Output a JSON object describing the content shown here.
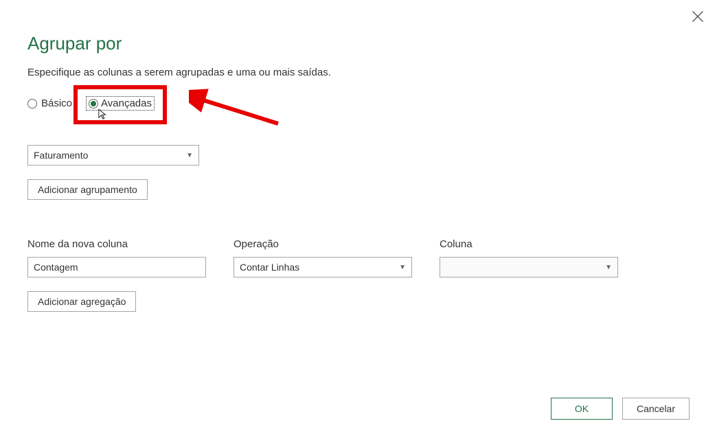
{
  "dialog": {
    "title": "Agrupar por",
    "subtitle": "Especifique as colunas a serem agrupadas e uma ou mais saídas."
  },
  "mode": {
    "basic_label": "Básico",
    "advanced_label": "Avançadas"
  },
  "grouping": {
    "column_value": "Faturamento",
    "add_button": "Adicionar agrupamento"
  },
  "aggregation": {
    "new_column_label": "Nome da nova coluna",
    "new_column_value": "Contagem",
    "operation_label": "Operação",
    "operation_value": "Contar Linhas",
    "column_label": "Coluna",
    "column_value": "",
    "add_button": "Adicionar agregação"
  },
  "footer": {
    "ok": "OK",
    "cancel": "Cancelar"
  }
}
